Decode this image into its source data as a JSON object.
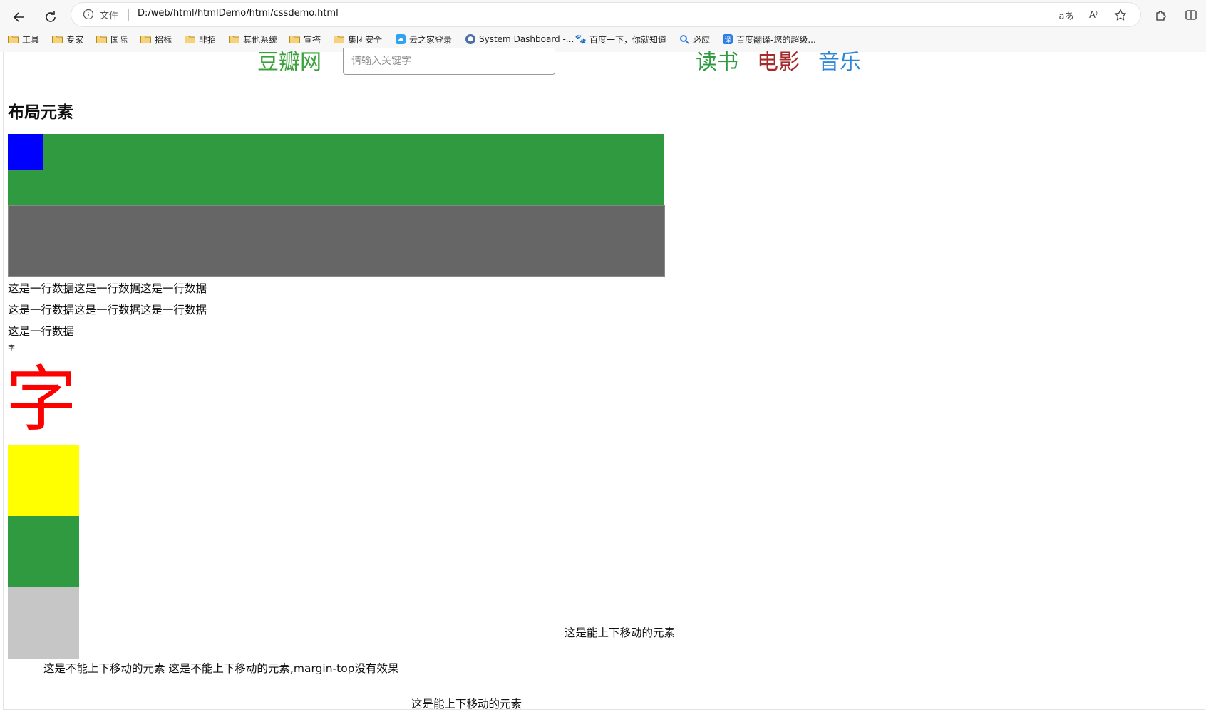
{
  "browser": {
    "scheme_label": "文件",
    "url": "D:/web/html/htmlDemo/html/cssdemo.html",
    "bookmarks": [
      {
        "label": "工具",
        "icon": "folder-icon"
      },
      {
        "label": "专家",
        "icon": "folder-icon"
      },
      {
        "label": "国际",
        "icon": "folder-icon"
      },
      {
        "label": "招标",
        "icon": "folder-icon"
      },
      {
        "label": "非招",
        "icon": "folder-icon"
      },
      {
        "label": "其他系统",
        "icon": "folder-icon"
      },
      {
        "label": "宣搭",
        "icon": "folder-icon"
      },
      {
        "label": "集团安全",
        "icon": "folder-icon"
      },
      {
        "label": "云之家登录",
        "icon": "cloud-icon"
      },
      {
        "label": "System Dashboard -...",
        "icon": "dashboard-icon"
      },
      {
        "label": "百度一下，你就知道",
        "icon": "baidu-paw-icon"
      },
      {
        "label": "必应",
        "icon": "bing-search-icon"
      },
      {
        "label": "百度翻译-您的超级...",
        "icon": "translate-icon"
      }
    ]
  },
  "page": {
    "logo": "豆瓣网",
    "search_placeholder": "请输入关键字",
    "nav": [
      {
        "label": "读书",
        "color": "#2f9a3f"
      },
      {
        "label": "电影",
        "color": "#a52a2a"
      },
      {
        "label": "音乐",
        "color": "#2b87d8"
      }
    ],
    "heading": "布局元素",
    "lines": [
      "这是一行数据这是一行数据这是一行数据",
      "这是一行数据这是一行数据这是一行数据",
      "这是一行数据"
    ],
    "small_char": "字",
    "big_char": "字",
    "movable_text_1": "这是能上下移动的元素",
    "non_movable_text": "这是不能上下移动的元素 这是不能上下移动的元素,margin-top没有效果",
    "movable_text_2": "这是能上下移动的元素",
    "colors": {
      "green": "#2f9a3f",
      "blue": "#0000ff",
      "gray": "#666666",
      "red": "#ff0000",
      "yellow": "#ffff00",
      "light_gray": "#c6c6c6"
    }
  }
}
